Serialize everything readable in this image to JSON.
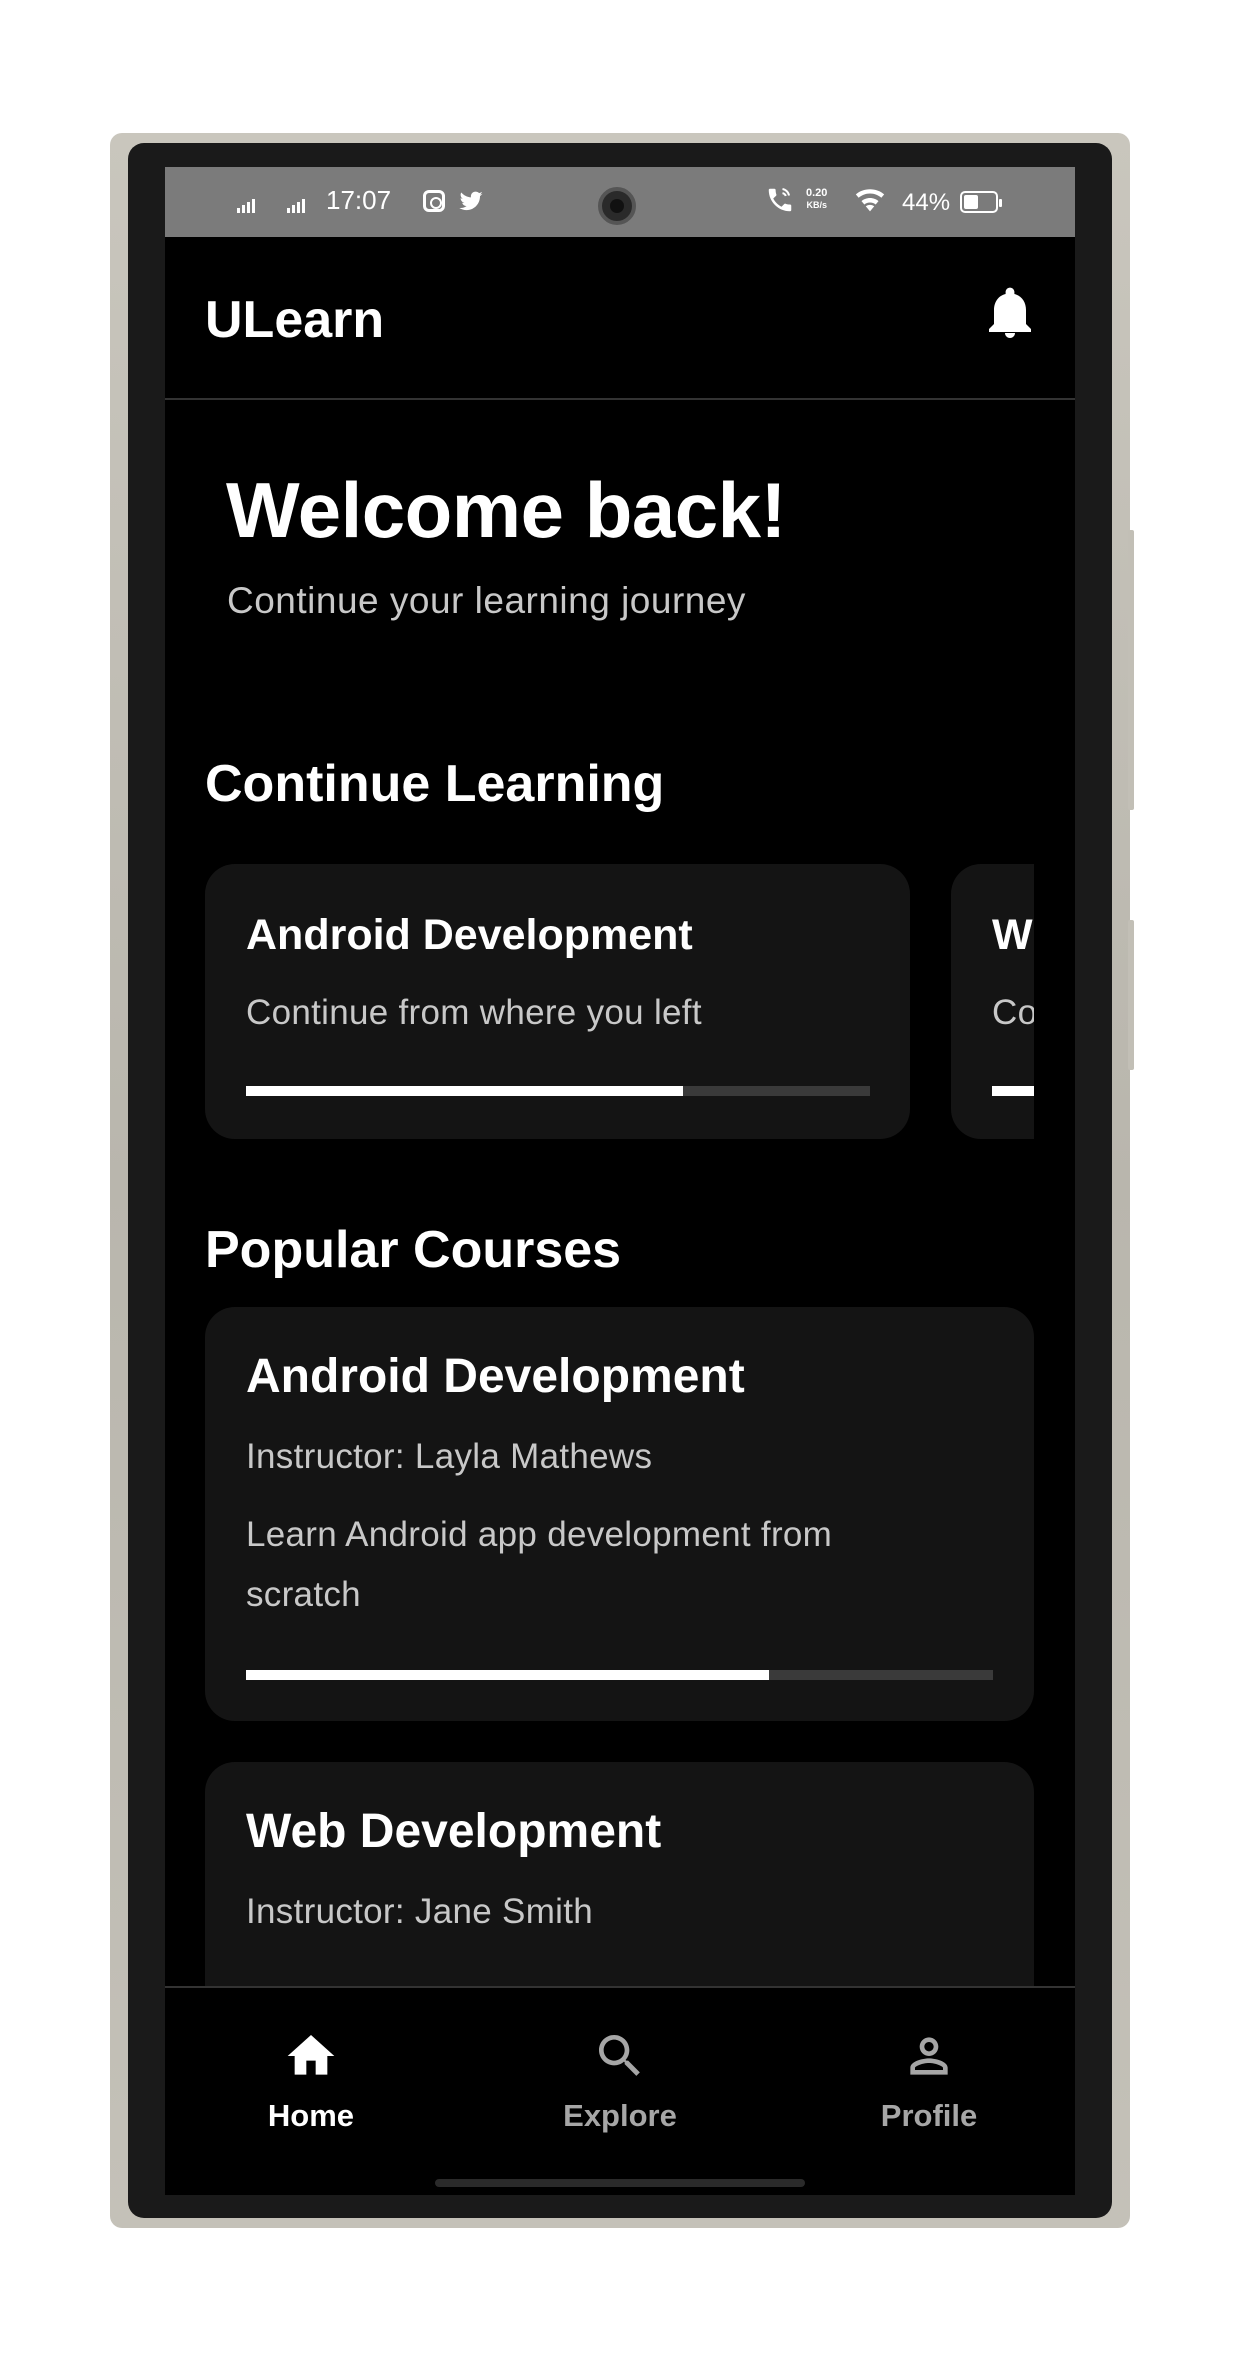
{
  "status_bar": {
    "time": "17:07",
    "data_speed_value": "0.20",
    "data_speed_unit": "KB/s",
    "battery_percent": "44%",
    "icons": [
      "signal-icon",
      "signal-icon",
      "instagram-icon",
      "twitter-icon",
      "wifi-calling-icon",
      "wifi-icon",
      "battery-icon"
    ]
  },
  "app_bar": {
    "title": "ULearn",
    "notification_icon": "bell-icon"
  },
  "welcome": {
    "heading": "Welcome back!",
    "subtitle": "Continue your learning journey"
  },
  "continue_learning": {
    "title": "Continue Learning",
    "cards": [
      {
        "title": "Android Development",
        "subtitle": "Continue from where you left",
        "progress": 0.7
      },
      {
        "title": "W",
        "subtitle": "Co",
        "progress": 0.7
      }
    ]
  },
  "popular_courses": {
    "title": "Popular Courses",
    "courses": [
      {
        "title": "Android Development",
        "instructor": "Instructor: Layla Mathews",
        "description": "Learn Android app development from scratch",
        "progress": 0.7
      },
      {
        "title": "Web Development",
        "instructor": "Instructor: Jane Smith"
      }
    ]
  },
  "bottom_nav": {
    "items": [
      {
        "label": "Home",
        "icon": "home-icon",
        "active": true
      },
      {
        "label": "Explore",
        "icon": "search-icon",
        "active": false
      },
      {
        "label": "Profile",
        "icon": "person-icon",
        "active": false
      }
    ]
  },
  "colors": {
    "background": "#000000",
    "card": "#141414",
    "text_primary": "#ffffff",
    "text_secondary": "#c8c8c8",
    "progress_track": "#3a3a3a",
    "nav_inactive": "#a6a6a6",
    "status_bar": "#7b7b7b"
  }
}
